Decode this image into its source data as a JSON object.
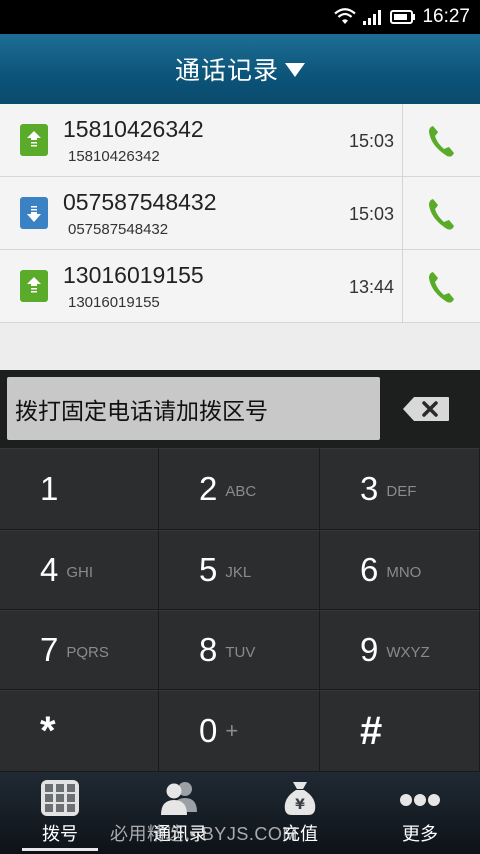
{
  "status_bar": {
    "time": "16:27"
  },
  "header": {
    "title": "通话记录"
  },
  "calls": [
    {
      "number": "15810426342",
      "sub": "15810426342",
      "time": "15:03",
      "direction": "outgoing"
    },
    {
      "number": "057587548432",
      "sub": "057587548432",
      "time": "15:03",
      "direction": "incoming"
    },
    {
      "number": "13016019155",
      "sub": "13016019155",
      "time": "13:44",
      "direction": "outgoing"
    }
  ],
  "dial_input": {
    "placeholder": "拨打固定电话请加拨区号"
  },
  "keypad": [
    {
      "digit": "1",
      "letters": ""
    },
    {
      "digit": "2",
      "letters": "ABC"
    },
    {
      "digit": "3",
      "letters": "DEF"
    },
    {
      "digit": "4",
      "letters": "GHI"
    },
    {
      "digit": "5",
      "letters": "JKL"
    },
    {
      "digit": "6",
      "letters": "MNO"
    },
    {
      "digit": "7",
      "letters": "PQRS"
    },
    {
      "digit": "8",
      "letters": "TUV"
    },
    {
      "digit": "9",
      "letters": "WXYZ"
    },
    {
      "digit": "*",
      "letters": ""
    },
    {
      "digit": "0",
      "letters": "+"
    },
    {
      "digit": "#",
      "letters": ""
    }
  ],
  "tabs": [
    {
      "label": "拨号",
      "icon": "keypad-grid-icon",
      "active": true
    },
    {
      "label": "通讯录",
      "icon": "contacts-icon",
      "active": false
    },
    {
      "label": "充值",
      "icon": "money-bag-icon",
      "active": false
    },
    {
      "label": "更多",
      "icon": "more-dots-icon",
      "active": false
    }
  ],
  "watermark": "必用精选 • BYJS.COM",
  "colors": {
    "title_bar": "#0c5479",
    "outgoing": "#5aab2a",
    "incoming": "#3b82c4",
    "call_button": "#5aab2a"
  }
}
